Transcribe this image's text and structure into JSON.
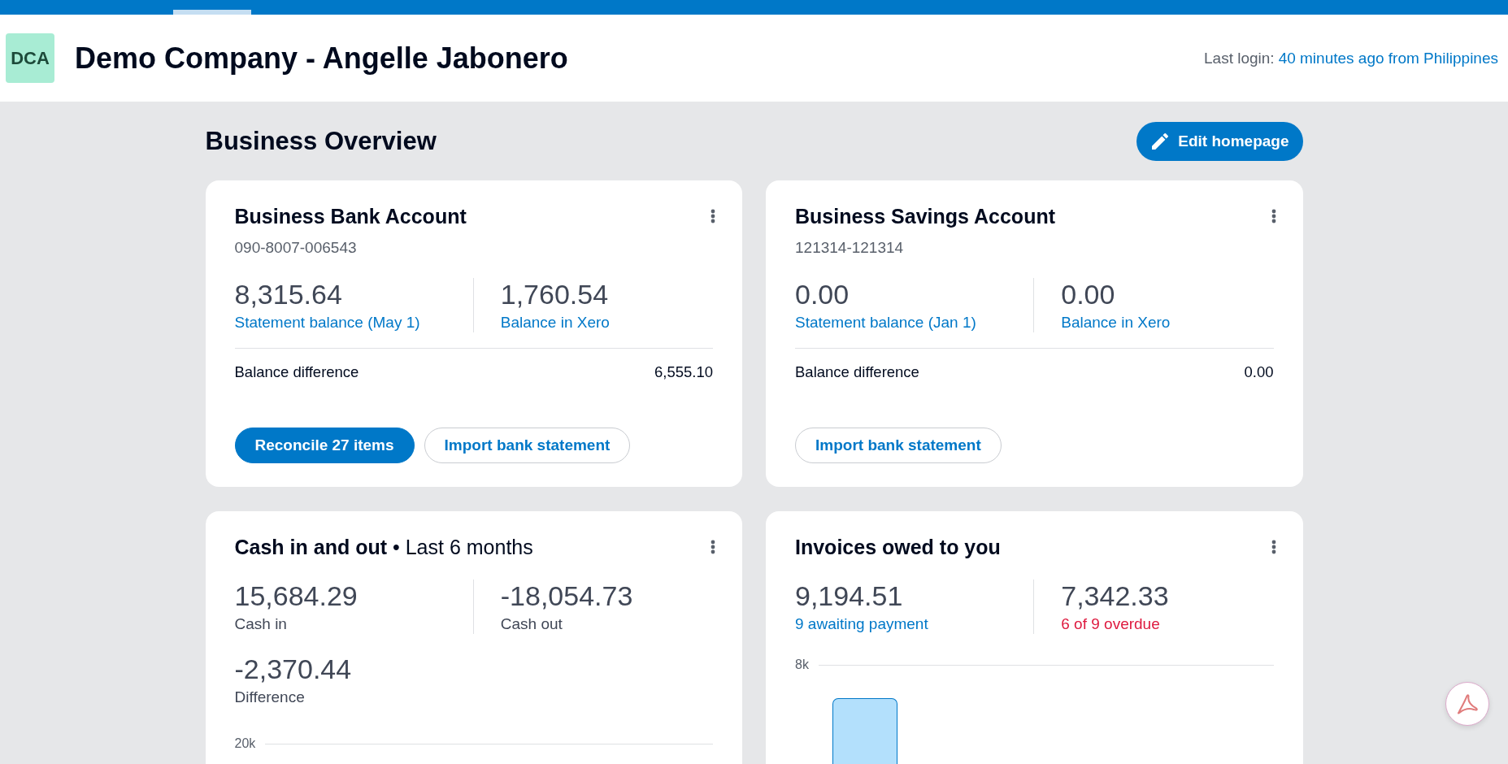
{
  "nav_bar": {
    "tabs": [
      {
        "selected": true
      }
    ]
  },
  "header": {
    "logo_initials": "DCA",
    "title": "Demo Company - Angelle Jabonero",
    "last_login": {
      "label": "Last login:",
      "link": "40 minutes ago from Philippines"
    }
  },
  "overview": {
    "title": "Business Overview",
    "edit_button": "Edit homepage"
  },
  "cards": [
    {
      "kind": "bank_account",
      "title": "Business Bank Account",
      "account_number": "090-8007-006543",
      "figures": [
        {
          "amount": "8,315.64",
          "label": "Statement balance (May 1)",
          "kind": "link"
        },
        {
          "amount": "1,760.54",
          "label": "Balance in Xero",
          "kind": "link"
        }
      ],
      "difference": {
        "label": "Balance difference",
        "amount": "6,555.10"
      },
      "buttons": [
        {
          "label": "Reconcile 27 items",
          "kind": "primary"
        },
        {
          "label": "Import bank statement",
          "kind": "secondary"
        }
      ]
    },
    {
      "kind": "bank_account",
      "title": "Business Savings Account",
      "account_number": "121314-121314",
      "figures": [
        {
          "amount": "0.00",
          "label": "Statement balance (Jan 1)",
          "kind": "link"
        },
        {
          "amount": "0.00",
          "label": "Balance in Xero",
          "kind": "link"
        }
      ],
      "difference": {
        "label": "Balance difference",
        "amount": "0.00"
      },
      "buttons": [
        {
          "label": "Import bank statement",
          "kind": "secondary"
        }
      ]
    },
    {
      "kind": "cash_flow",
      "title": "Cash in and out",
      "subtitle": "• Last 6 months",
      "figures": [
        {
          "amount": "15,684.29",
          "label": "Cash in",
          "kind": "plain"
        },
        {
          "amount": "-18,054.73",
          "label": "Cash out",
          "kind": "plain"
        }
      ],
      "total": {
        "amount": "-2,370.44",
        "label": "Difference"
      },
      "chart": {
        "top_tick": "20k"
      }
    },
    {
      "kind": "invoices",
      "title": "Invoices owed to you",
      "figures": [
        {
          "amount": "9,194.51",
          "label": "9 awaiting payment",
          "kind": "link"
        },
        {
          "amount": "7,342.33",
          "label": "6 of 9 overdue",
          "kind": "alert"
        }
      ],
      "chart": {
        "top_tick": "8k"
      }
    }
  ]
}
